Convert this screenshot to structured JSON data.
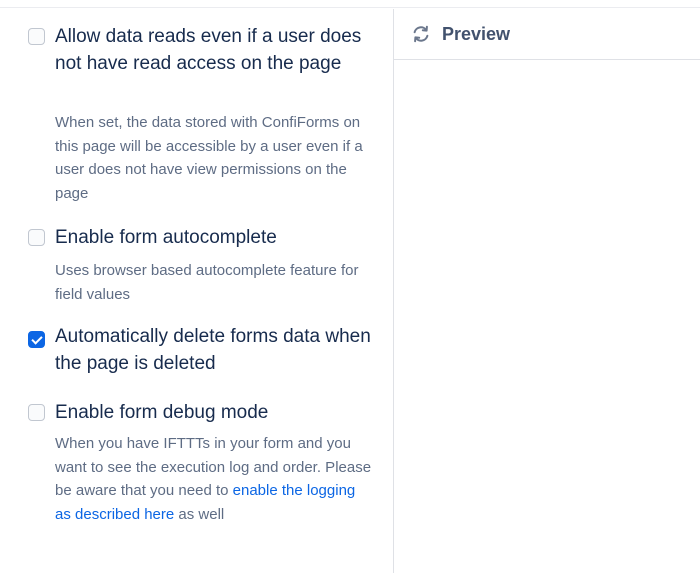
{
  "options": [
    {
      "label": "Allow data reads even if a user does not have read access on the page",
      "description": "When set, the data stored with ConfiForms on this page will be accessible by a user even if a user does not have view permissions on the page",
      "checked": false
    },
    {
      "label": "Enable form autocomplete",
      "description": "Uses browser based autocomplete feature for field values",
      "checked": false
    },
    {
      "label": "Automatically delete forms data when the page is deleted",
      "checked": true
    },
    {
      "label": "Enable form debug mode",
      "description_before_link": "When you have IFTTTs in your form and you want to see the execution log and order. Please be aware that you need to ",
      "link_text": "enable the logging as described here",
      "description_after_link": " as well",
      "checked": false
    }
  ],
  "preview": {
    "title": "Preview",
    "icon": "refresh-icon"
  },
  "colors": {
    "checkbox_checked": "#0c66e4",
    "link": "#0c66e4",
    "description_text": "#5e6c84",
    "label_text": "#172b4d"
  }
}
